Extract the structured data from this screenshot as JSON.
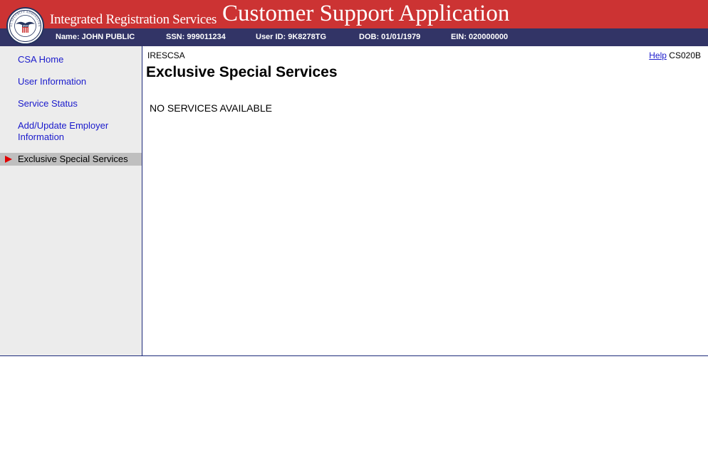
{
  "header": {
    "app_title": "Customer Support Application",
    "system_title": "Integrated Registration Services",
    "seal_text": "SOCIAL SECURITY ADMINISTRATION",
    "seal_center": "USA",
    "colors": {
      "banner": "#cc3333",
      "info_bar": "#323466"
    }
  },
  "user_info": {
    "name": "Name: JOHN PUBLIC",
    "ssn": "SSN: 999011234",
    "user_id": "User ID: 9K8278TG",
    "dob": "DOB: 01/01/1979",
    "ein": "EIN: 020000000"
  },
  "sidebar": {
    "items": [
      {
        "label": "CSA Home"
      },
      {
        "label": "User Information"
      },
      {
        "label": "Service Status"
      },
      {
        "label": "Add/Update Employer Information"
      },
      {
        "label": "Exclusive Special Services",
        "active": true
      }
    ]
  },
  "main": {
    "system_name": "IRESCSA",
    "help_label": "Help",
    "screen_id": "CS020B",
    "page_title": "Exclusive Special Services",
    "message": "NO SERVICES AVAILABLE"
  }
}
